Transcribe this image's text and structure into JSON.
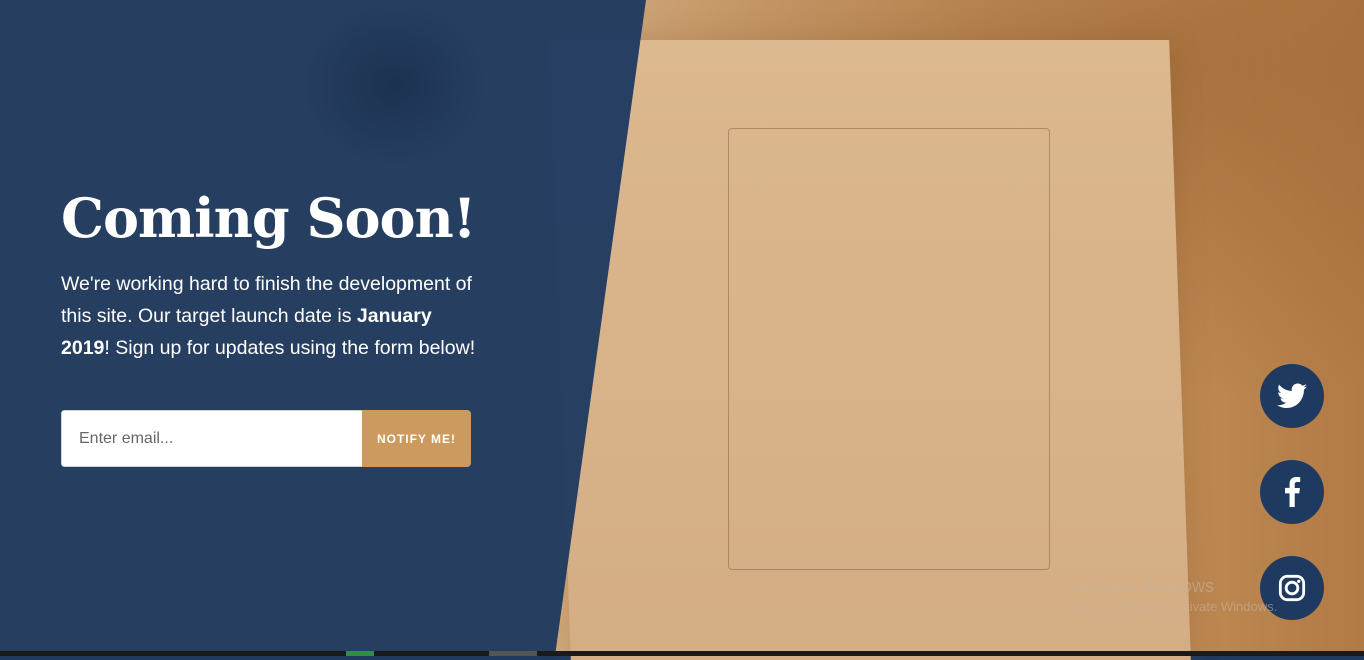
{
  "hero": {
    "title": "Coming Soon!",
    "text_part1": "We're working hard to finish the development of this site. Our target launch date is ",
    "text_bold": "January 2019",
    "text_part2": "! Sign up for updates using the form below!"
  },
  "signup": {
    "email_placeholder": "Enter email...",
    "button_label": "NOTIFY ME!"
  },
  "social": [
    {
      "icon": "twitter-icon"
    },
    {
      "icon": "facebook-icon"
    },
    {
      "icon": "instagram-icon"
    }
  ],
  "watermark": {
    "line1": "Activate Windows",
    "line2": "Go to Settings to activate Windows."
  },
  "colors": {
    "primary_blue": "#1f3a60",
    "accent_tan": "#cc9a5f"
  }
}
